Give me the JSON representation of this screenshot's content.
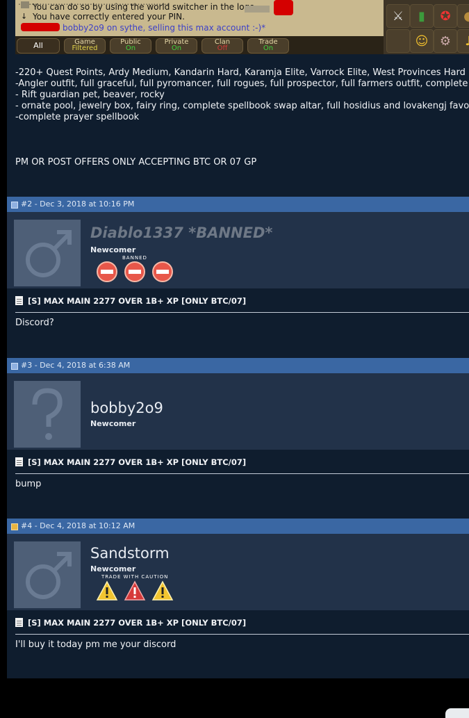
{
  "game": {
    "chat": [
      {
        "text": "You can do so by using the world switcher in the logo",
        "color": "black"
      },
      {
        "text": "You have correctly entered your PIN.",
        "color": "black"
      },
      {
        "text": "bobby2o9 on sythe, selling this max account :-)*",
        "color": "blue"
      }
    ],
    "tabs": [
      {
        "label": "All",
        "status": ""
      },
      {
        "label": "Game",
        "status": "Filtered"
      },
      {
        "label": "Public",
        "status": "On"
      },
      {
        "label": "Private",
        "status": "On"
      },
      {
        "label": "Clan",
        "status": "Off"
      },
      {
        "label": "Trade",
        "status": "On"
      }
    ]
  },
  "first_post": {
    "lines": [
      "-220+ Quest Points, Ardy Medium, Kandarin Hard, Karamja Elite, Varrock Elite, West Provinces Hard",
      "-Angler outfit, full graceful, full pyromancer, full rogues, full prospector, full farmers outfit, complete",
      "- Rift guardian pet, beaver, rocky",
      "- ornate pool, jewelry box, fairy ring, complete spellbook swap altar, full hosidius and lovakengj favor",
      "-complete prayer spellbook"
    ],
    "closing": "PM OR POST OFFERS ONLY ACCEPTING BTC OR 07 GP"
  },
  "posts": [
    {
      "header": "#2 - Dec 3, 2018 at 10:16 PM",
      "username": "Diablo1337 *BANNED*",
      "user_title": "Newcomer",
      "badge_label": "BANNED",
      "thread_title": "[S] MAX MAIN 2277 OVER 1B+ XP [ONLY BTC/07]",
      "message": "Discord?"
    },
    {
      "header": "#3 - Dec 4, 2018 at 6:38 AM",
      "username": "bobby2o9",
      "user_title": "Newcomer",
      "thread_title": "[S] MAX MAIN 2277 OVER 1B+ XP [ONLY BTC/07]",
      "message": "bump"
    },
    {
      "header": "#4 - Dec 4, 2018 at 10:12 AM",
      "username": "Sandstorm",
      "user_title": "Newcomer",
      "badge_label": "TRADE WITH CAUTION",
      "thread_title": "[S] MAX MAIN 2277 OVER 1B+ XP [ONLY BTC/07]",
      "message": "I'll buy it today pm me your discord"
    }
  ],
  "colors": {
    "page_bg": "#0f1d2e",
    "post_header": "#3a67a3",
    "user_panel": "#223249",
    "ban_badge": "#e8574a",
    "warn_yellow": "#f2c530",
    "warn_red": "#d63a3a"
  }
}
